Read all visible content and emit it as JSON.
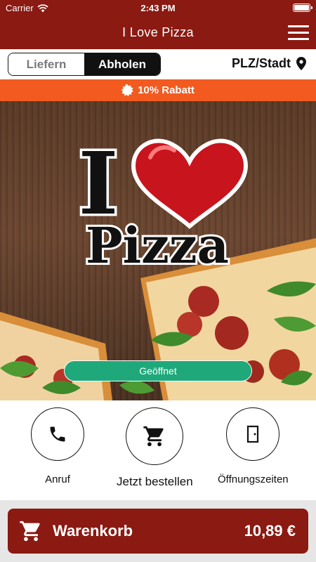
{
  "status_bar": {
    "carrier": "Carrier",
    "time": "2:43 PM"
  },
  "nav": {
    "title": "I Love Pizza"
  },
  "mode": {
    "delivery_label": "Liefern",
    "pickup_label": "Abholen",
    "selected": "Abholen"
  },
  "location": {
    "label": "PLZ/Stadt"
  },
  "discount": {
    "label": "10% Rabatt"
  },
  "hero": {
    "logo_text_top": "I",
    "logo_text_bottom": "Pizza",
    "status_label": "Geöffnet"
  },
  "actions": [
    {
      "label": "Anruf",
      "icon": "phone-icon"
    },
    {
      "label": "Jetzt bestellen",
      "icon": "cart-icon"
    },
    {
      "label": "Öffnungszeiten",
      "icon": "door-icon"
    }
  ],
  "cart": {
    "label": "Warenkorb",
    "total": "10,89 €"
  },
  "colors": {
    "brand": "#8a1a12",
    "discount": "#f25a1f",
    "open": "#1fa97a"
  }
}
